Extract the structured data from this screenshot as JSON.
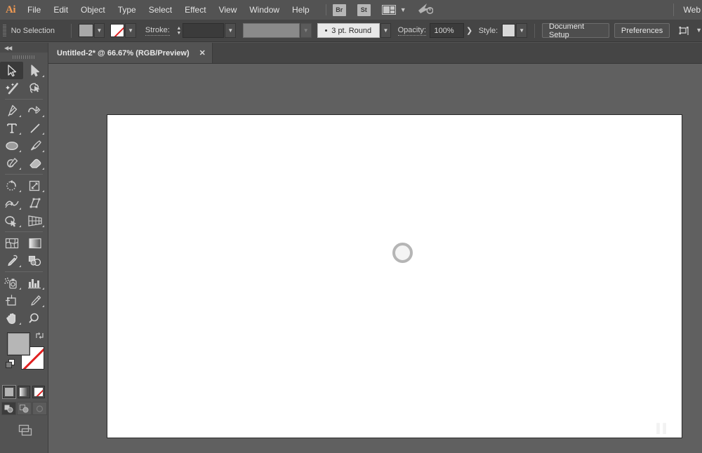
{
  "app": {
    "name": "Ai",
    "logo_color": "#f09a53"
  },
  "menubar": {
    "items": [
      {
        "label": "File"
      },
      {
        "label": "Edit"
      },
      {
        "label": "Object"
      },
      {
        "label": "Type"
      },
      {
        "label": "Select"
      },
      {
        "label": "Effect"
      },
      {
        "label": "View"
      },
      {
        "label": "Window"
      },
      {
        "label": "Help"
      }
    ],
    "bridge_label": "Br",
    "stock_label": "St",
    "arrange_icon": "arrange-documents-icon",
    "cc_icon": "creative-cloud-icon",
    "workspace_label": "Web"
  },
  "controlbar": {
    "selection_status": "No Selection",
    "fill_swatch_color": "#a8a8a8",
    "stroke_swatch_value": "None",
    "stroke_label": "Stroke:",
    "stroke_weight_value": "",
    "stroke_profile_value": "",
    "brush_definition": "3 pt. Round",
    "opacity_label": "Opacity:",
    "opacity_value": "100%",
    "style_label": "Style:",
    "style_swatch_color": "#d8d8d8",
    "document_setup_label": "Document Setup",
    "preferences_label": "Preferences",
    "align_icon": "align-transform-icon"
  },
  "tabbar": {
    "tabs": [
      {
        "title": "Untitled-2* @ 66.67% (RGB/Preview)",
        "close_label": "✕",
        "active": true
      }
    ]
  },
  "toolbar": {
    "collapse_icon": "collapse-panel-icon",
    "tools": [
      {
        "name": "selection-tool",
        "selected": true,
        "corner": false
      },
      {
        "name": "direct-selection-tool",
        "selected": false,
        "corner": true
      },
      {
        "name": "magic-wand-tool",
        "selected": false,
        "corner": false
      },
      {
        "name": "lasso-tool",
        "selected": false,
        "corner": false
      },
      {
        "name": "pen-tool",
        "selected": false,
        "corner": true
      },
      {
        "name": "curvature-tool",
        "selected": false,
        "corner": true
      },
      {
        "name": "type-tool",
        "selected": false,
        "corner": true
      },
      {
        "name": "line-segment-tool",
        "selected": false,
        "corner": true
      },
      {
        "name": "ellipse-tool",
        "selected": false,
        "corner": true
      },
      {
        "name": "paintbrush-tool",
        "selected": false,
        "corner": true
      },
      {
        "name": "shaper-tool",
        "selected": false,
        "corner": true
      },
      {
        "name": "eraser-tool",
        "selected": false,
        "corner": true
      },
      {
        "name": "rotate-tool",
        "selected": false,
        "corner": true
      },
      {
        "name": "scale-tool",
        "selected": false,
        "corner": true
      },
      {
        "name": "width-tool",
        "selected": false,
        "corner": true
      },
      {
        "name": "free-transform-tool",
        "selected": false,
        "corner": false
      },
      {
        "name": "shape-builder-tool",
        "selected": false,
        "corner": true
      },
      {
        "name": "perspective-grid-tool",
        "selected": false,
        "corner": true
      },
      {
        "name": "mesh-tool",
        "selected": false,
        "corner": false
      },
      {
        "name": "gradient-tool",
        "selected": false,
        "corner": false
      },
      {
        "name": "eyedropper-tool",
        "selected": false,
        "corner": true
      },
      {
        "name": "blend-tool",
        "selected": false,
        "corner": false
      },
      {
        "name": "symbol-sprayer-tool",
        "selected": false,
        "corner": true
      },
      {
        "name": "column-graph-tool",
        "selected": false,
        "corner": true
      },
      {
        "name": "artboard-tool",
        "selected": false,
        "corner": false
      },
      {
        "name": "slice-tool",
        "selected": false,
        "corner": true
      },
      {
        "name": "hand-tool",
        "selected": false,
        "corner": true
      },
      {
        "name": "zoom-tool",
        "selected": false,
        "corner": false
      }
    ],
    "fill_color": "#b6b6b6",
    "stroke_color": "None",
    "swap_icon": "swap-fill-stroke-icon",
    "default_icon": "default-fill-stroke-icon",
    "color_modes": [
      {
        "name": "color-swatch-mode",
        "active": true
      },
      {
        "name": "gradient-swatch-mode",
        "active": false
      },
      {
        "name": "none-swatch-mode",
        "active": false
      }
    ],
    "drawing_modes": [
      {
        "name": "draw-normal-mode",
        "active": true
      },
      {
        "name": "draw-behind-mode",
        "active": false
      },
      {
        "name": "draw-inside-mode",
        "active": false
      }
    ],
    "screen_mode": "change-screen-mode-icon"
  },
  "canvas": {
    "background_color": "#606060",
    "artboard_color": "#ffffff",
    "zoom_level": "66.67%",
    "objects": [
      {
        "name": "ellipse-shape",
        "type": "ellipse",
        "stroke_color": "#b5b5b5",
        "fill_color": "#f4f4f4"
      }
    ],
    "watermark": "▐▐"
  }
}
